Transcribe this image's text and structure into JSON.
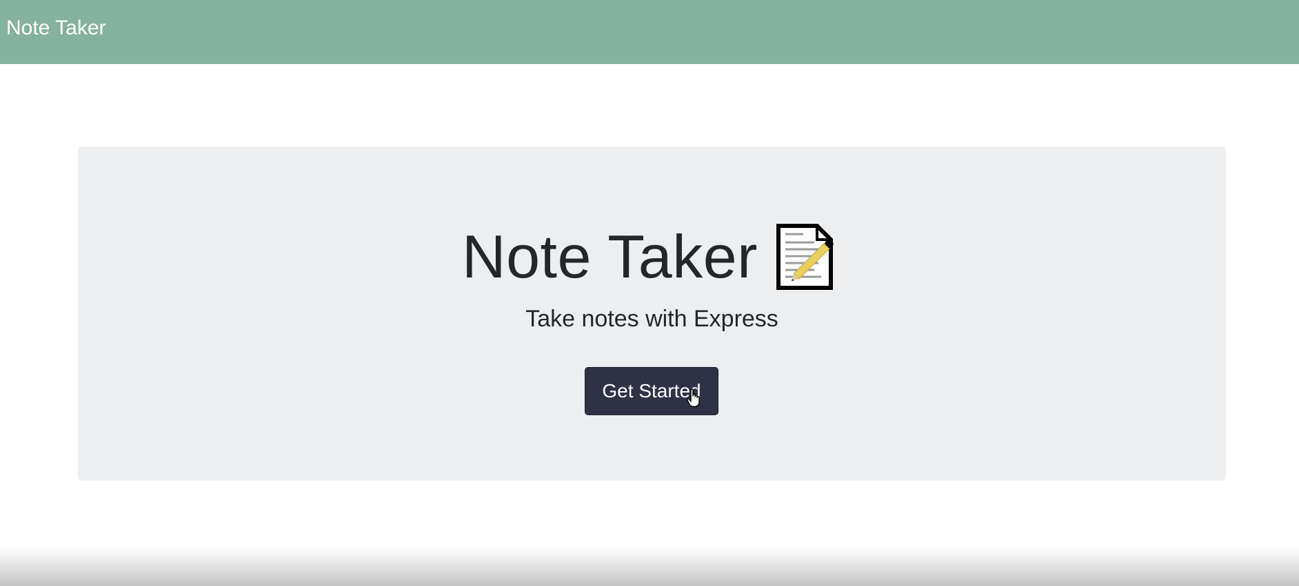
{
  "navbar": {
    "brand": "Note Taker",
    "background": "#85b29e"
  },
  "hero": {
    "title": "Note Taker",
    "title_icon": "memo-icon",
    "subtitle": "Take notes with Express",
    "cta_label": "Get Started",
    "cta_color": "#2e3244",
    "panel_color": "#edeef0"
  },
  "cursor": "pointer-hand-icon"
}
